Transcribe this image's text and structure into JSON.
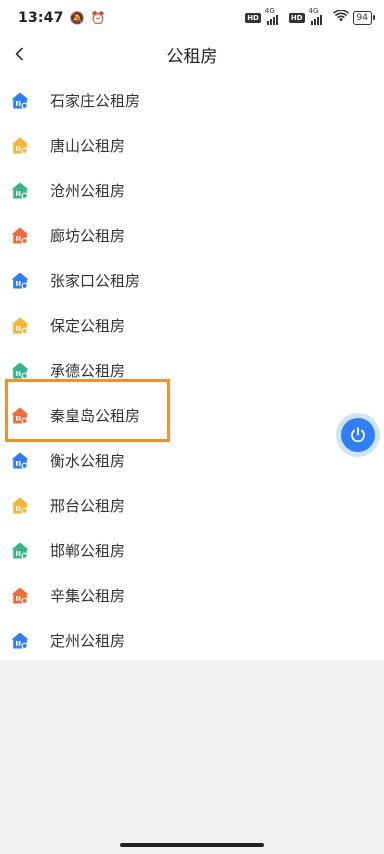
{
  "status_bar": {
    "time": "13:47",
    "network_label": "4G",
    "battery": "94"
  },
  "header": {
    "title": "公租房"
  },
  "list": {
    "items": [
      {
        "label": "石家庄公租房",
        "icon_color": "#2f7ef2"
      },
      {
        "label": "唐山公租房",
        "icon_color": "#f4b43a"
      },
      {
        "label": "沧州公租房",
        "icon_color": "#37b48a"
      },
      {
        "label": "廊坊公租房",
        "icon_color": "#ee6b3b"
      },
      {
        "label": "张家口公租房",
        "icon_color": "#2f7ef2"
      },
      {
        "label": "保定公租房",
        "icon_color": "#f4b43a"
      },
      {
        "label": "承德公租房",
        "icon_color": "#37b48a"
      },
      {
        "label": "秦皇岛公租房",
        "icon_color": "#ee6b3b"
      },
      {
        "label": "衡水公租房",
        "icon_color": "#2f7ef2"
      },
      {
        "label": "邢台公租房",
        "icon_color": "#f4b43a"
      },
      {
        "label": "邯郸公租房",
        "icon_color": "#37b48a"
      },
      {
        "label": "辛集公租房",
        "icon_color": "#ee6b3b"
      },
      {
        "label": "定州公租房",
        "icon_color": "#2f7ef2"
      }
    ]
  },
  "highlighted_item": "秦皇岛公租房",
  "colors": {
    "highlight_border": "#f0922b",
    "float_button": "#2f7ef2"
  }
}
